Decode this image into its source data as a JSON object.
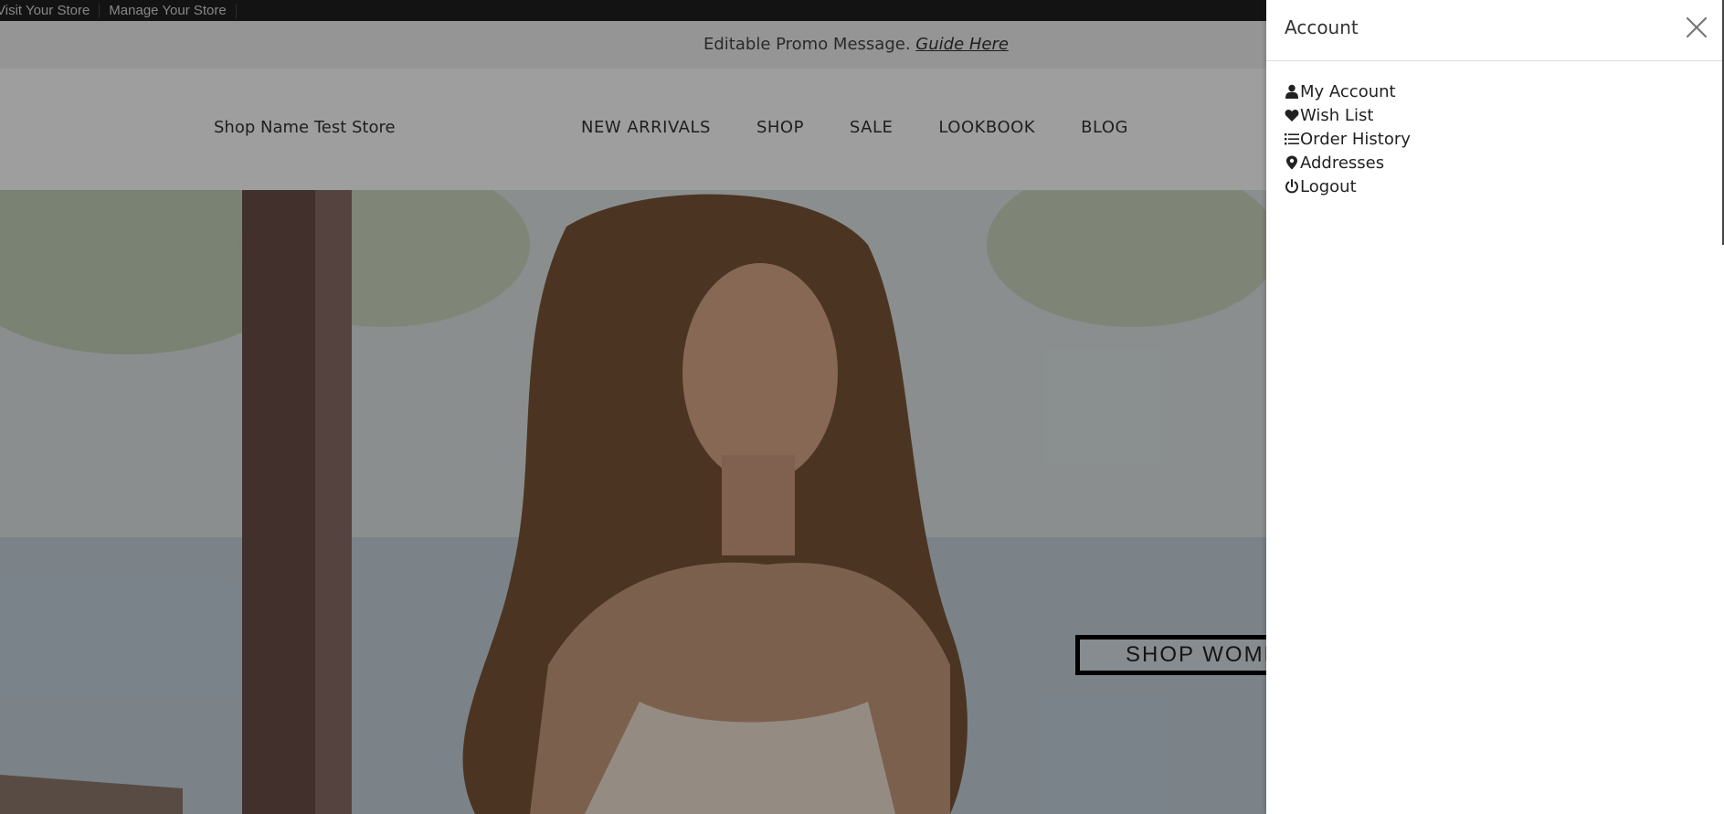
{
  "admin_bar": {
    "links": [
      "Visit Your Store",
      "Manage Your Store"
    ]
  },
  "promo": {
    "message": "Editable Promo Message.",
    "link_text": "Guide Here"
  },
  "header": {
    "shop_name": "Shop Name Test Store",
    "nav": [
      "NEW ARRIVALS",
      "SHOP",
      "SALE",
      "LOOKBOOK",
      "BLOG"
    ]
  },
  "hero": {
    "button_label": "SHOP WOMEN"
  },
  "drawer": {
    "title": "Account",
    "close_icon": "close-icon",
    "items": [
      {
        "label": "My Account",
        "icon": "user-icon"
      },
      {
        "label": "Wish List",
        "icon": "heart-icon"
      },
      {
        "label": "Order History",
        "icon": "list-icon"
      },
      {
        "label": "Addresses",
        "icon": "map-pin-icon"
      },
      {
        "label": "Logout",
        "icon": "power-icon"
      }
    ]
  },
  "colors": {
    "overlay": "#000000",
    "drawer_bg": "#ffffff",
    "text": "#222222"
  }
}
